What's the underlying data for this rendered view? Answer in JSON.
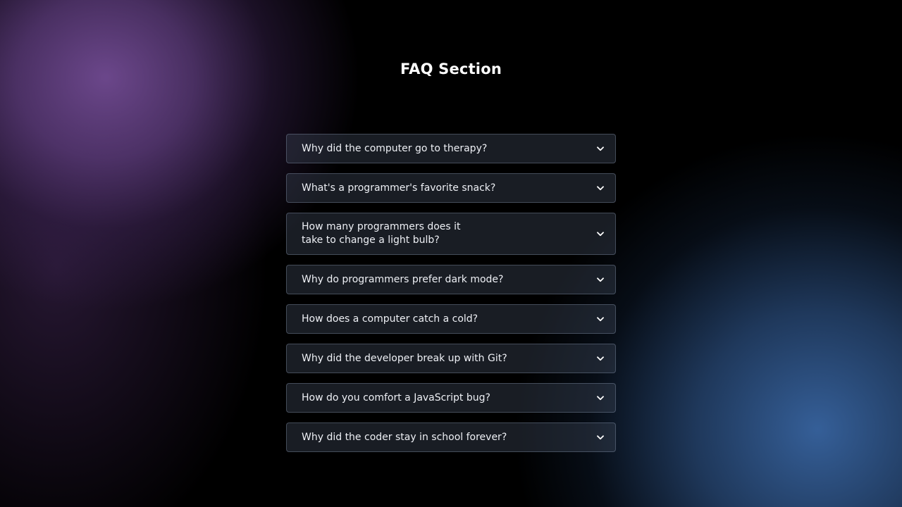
{
  "page": {
    "title": "FAQ Section"
  },
  "faq": {
    "items": [
      {
        "question": "Why did the computer go to therapy?",
        "icon": "chevron-down-icon"
      },
      {
        "question": "What's a programmer's favorite snack?",
        "icon": "chevron-down-icon"
      },
      {
        "question": "How many programmers does it take to change a light bulb?",
        "icon": "chevron-down-icon"
      },
      {
        "question": "Why do programmers prefer dark mode?",
        "icon": "chevron-down-icon"
      },
      {
        "question": "How does a computer catch a cold?",
        "icon": "chevron-down-icon"
      },
      {
        "question": "Why did the developer break up with Git?",
        "icon": "chevron-down-icon"
      },
      {
        "question": "How do you comfort a JavaScript bug?",
        "icon": "chevron-down-icon"
      },
      {
        "question": "Why did the coder stay in school forever?",
        "icon": "chevron-down-icon"
      }
    ]
  },
  "colors": {
    "background": "#000000",
    "accent_purple": "#704A91",
    "accent_blue": "#3864A0",
    "text": "#FFFFFF"
  }
}
